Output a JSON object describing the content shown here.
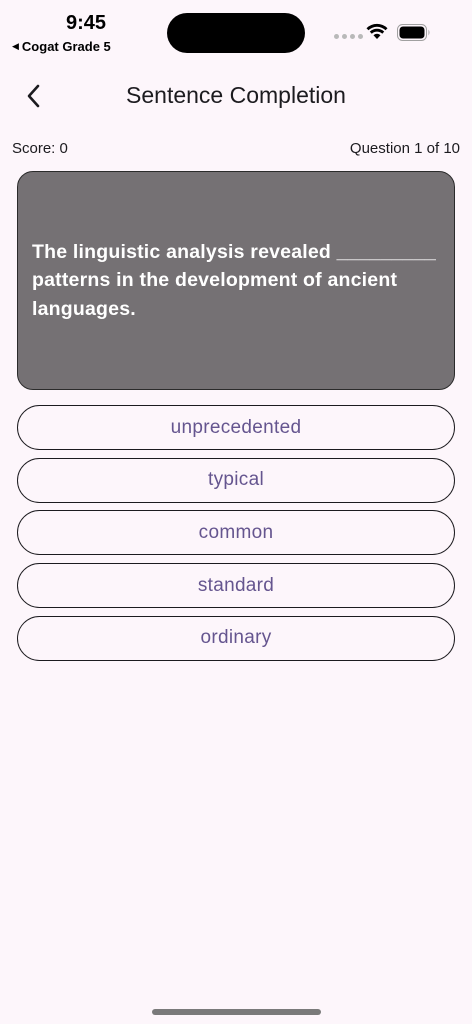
{
  "status_bar": {
    "time": "9:45",
    "back_app_label": "Cogat Grade 5",
    "icons": [
      "signal-icon",
      "wifi-icon",
      "battery-icon"
    ]
  },
  "header": {
    "title": "Sentence Completion",
    "back_icon": "chevron-left-icon"
  },
  "score": {
    "label": "Score: 0",
    "progress": "Question 1 of 10"
  },
  "question": {
    "text": "The linguistic analysis revealed _________ patterns in the development of ancient languages."
  },
  "options": [
    {
      "label": "unprecedented"
    },
    {
      "label": "typical"
    },
    {
      "label": "common"
    },
    {
      "label": "standard"
    },
    {
      "label": "ordinary"
    }
  ],
  "colors": {
    "background": "#fdf6fb",
    "card": "#757174",
    "option_text": "#65558f"
  }
}
